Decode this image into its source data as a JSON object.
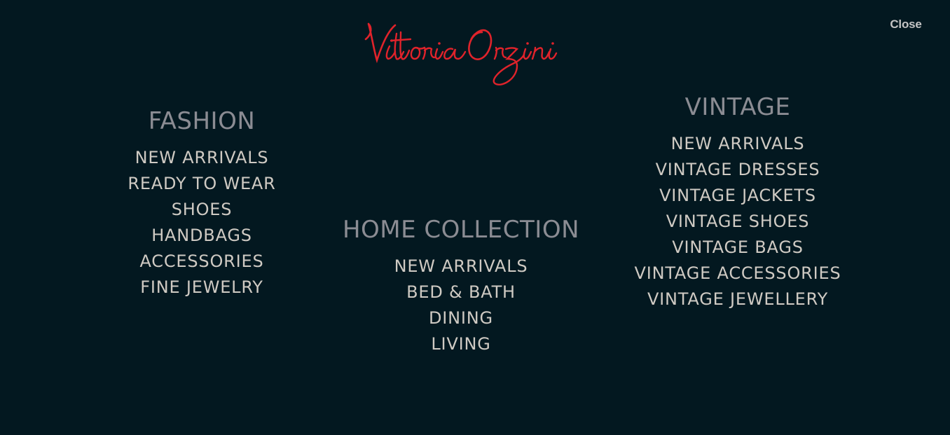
{
  "brand": {
    "logo_text": "Vittoria Orzini",
    "logo_color": "#e0232b"
  },
  "header": {
    "close_label": "Close"
  },
  "menu": {
    "fashion": {
      "title": "FASHION",
      "items": [
        "NEW ARRIVALS",
        "READY TO WEAR",
        "SHOES",
        "HANDBAGS",
        "ACCESSORIES",
        "FINE JEWELRY"
      ]
    },
    "home_collection": {
      "title": "HOME COLLECTION",
      "items": [
        "NEW ARRIVALS",
        "BED & BATH",
        "DINING",
        "LIVING"
      ]
    },
    "vintage": {
      "title": "VINTAGE",
      "items": [
        "NEW ARRIVALS",
        "VINTAGE DRESSES",
        "VINTAGE JACKETS",
        "VINTAGE SHOES",
        "VINTAGE BAGS",
        "VINTAGE ACCESSORIES",
        "VINTAGE JEWELLERY"
      ]
    }
  },
  "colors": {
    "background": "#031820",
    "heading": "#8b8c93",
    "link": "#cfcac3",
    "close": "#c4c4c4"
  }
}
